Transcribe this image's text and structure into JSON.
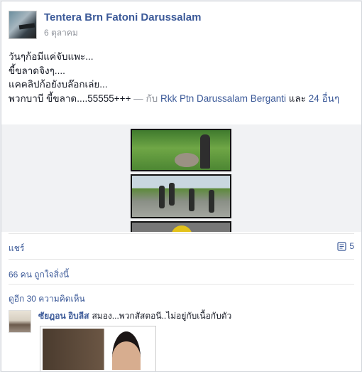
{
  "post": {
    "author": "Tentera Brn Fatoni Darussalam",
    "date": "6 ตุลาคม",
    "lines": [
      "วันๆก้อมีแค่จับแพะ...",
      "ขี้ขลาดจิงๆ....",
      "แคคลิปก้อยังบล๊อกเล่ย...",
      "พวกบาบี ขี้ขลาด....55555+++"
    ],
    "dash": "—",
    "with_prefix": "กับ",
    "tagged": "Rkk Ptn Darussalam Berganti",
    "and_word": "และ",
    "others": "24 อื่นๆ"
  },
  "actions": {
    "share_label": "แชร์",
    "comment_count": "5",
    "comment_count_icon": "comment-icon"
  },
  "likes": {
    "text": "66 คน ถูกใจสิ่งนี้"
  },
  "comments_link": {
    "text": "ดูอีก 30 ความคิดเห็น"
  },
  "comment": {
    "author": "ซัยฎอน อิบลีส",
    "text": "สมอง...พวกสัสตอนี..ไม่อยู่กับเนื้อกับตัว"
  }
}
